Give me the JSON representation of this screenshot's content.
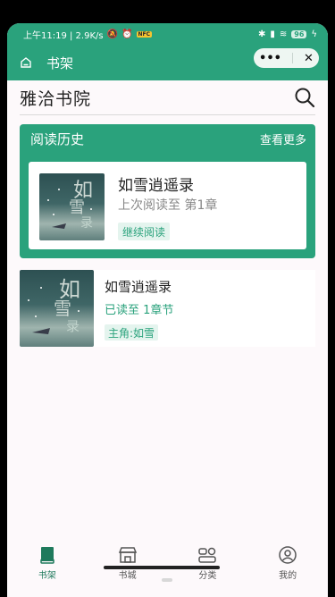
{
  "status_bar": {
    "time_speed": "上午11:19 | 2.9K/s",
    "battery": "96",
    "nfc_badge": "NFC"
  },
  "navbar": {
    "title": "书架",
    "more_label": "•••",
    "close_label": "✕"
  },
  "header": {
    "app_title": "雅洽书院"
  },
  "history": {
    "title": "阅读历史",
    "see_more": "查看更多",
    "book": {
      "name": "如雪逍遥录",
      "last_read": "上次阅读至 第1章",
      "continue_label": "继续阅读"
    }
  },
  "shelf": {
    "items": [
      {
        "name": "如雪逍遥录",
        "read_progress": "已读至 1章节",
        "tag": "主角:如雪"
      }
    ]
  },
  "tabbar": {
    "tabs": [
      {
        "label": "书架",
        "active": true
      },
      {
        "label": "书城",
        "active": false
      },
      {
        "label": "分类",
        "active": false
      },
      {
        "label": "我的",
        "active": false
      }
    ]
  },
  "colors": {
    "accent": "#2aa27c",
    "accent_light": "#e4f4ee"
  }
}
